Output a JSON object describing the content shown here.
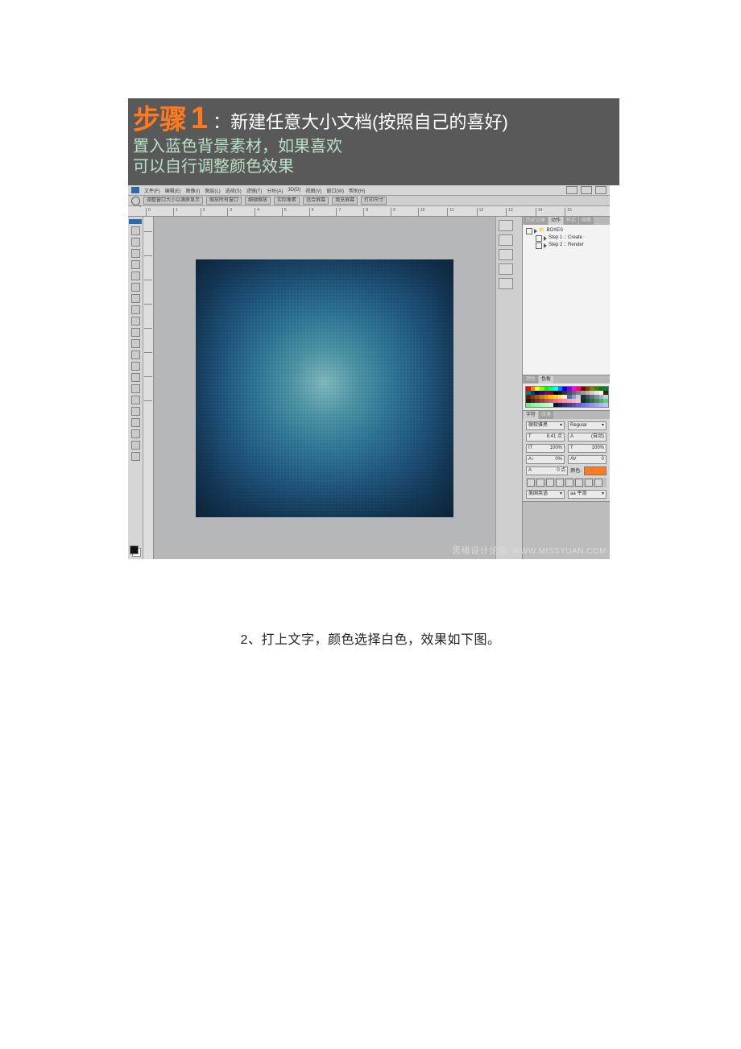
{
  "banner": {
    "step_label": "步骤",
    "step_num": "1",
    "desc": "：新建任意大小文档(按照自己的喜好)",
    "line2": "置入蓝色背景素材，如果喜欢",
    "line3": "可以自行调整颜色效果"
  },
  "menubar": {
    "items": [
      "文件(F)",
      "编辑(E)",
      "图像(I)",
      "图层(L)",
      "选择(S)",
      "滤镜(T)",
      "分析(A)",
      "3D(D)",
      "视图(V)",
      "窗口(W)",
      "帮助(H)"
    ]
  },
  "optbar": {
    "items": [
      "调整窗口大小以满屏显示",
      "缩放所有窗口",
      "细微缩放",
      "实际像素",
      "适合屏幕",
      "填充屏幕",
      "打印尺寸"
    ]
  },
  "ruler_h": [
    "0",
    "1",
    "2",
    "3",
    "4",
    "5",
    "6",
    "7",
    "8",
    "9",
    "10",
    "11",
    "12",
    "13",
    "14",
    "15"
  ],
  "actions": {
    "tab_on": "动作",
    "tab_off1": "历史记录",
    "tab_off2": "样式",
    "tab_off3": "画笔",
    "folder": "BOXES",
    "step1": "Step 1 :: Create",
    "step2": "Step 2 :: Render"
  },
  "swatches": {
    "tab_on": "色板",
    "tab_off": "颜色"
  },
  "typo": {
    "tab_on": "字符",
    "tab_off": "段落",
    "font": "微软雅黑",
    "style": "Regular",
    "size": "8.41 点",
    "leading": "(自动)",
    "tracking": "100%",
    "vscale": "100%",
    "baseline": "0%",
    "color_row_label": "0 点",
    "color_label": "颜色:",
    "lang": "美国英语",
    "aa": "aa  平滑"
  },
  "watermark": {
    "zh": "思缘设计论坛",
    "en": "WWW.MISSYUAN.COM"
  },
  "caption": "2、打上文字，颜色选择白色，效果如下图。",
  "swatch_colors": [
    "#ff0000",
    "#ff7f00",
    "#ffff00",
    "#7fff00",
    "#00ff00",
    "#00ff7f",
    "#00ffff",
    "#007fff",
    "#0000ff",
    "#7f00ff",
    "#ff00ff",
    "#ff007f",
    "#7f0000",
    "#7f3f00",
    "#7f7f00",
    "#3f7f00",
    "#007f00",
    "#007f3f",
    "#007f7f",
    "#003f7f",
    "#00007f",
    "#3f007f",
    "#7f007f",
    "#7f003f",
    "#000000",
    "#191919",
    "#333333",
    "#4c4c4c",
    "#666666",
    "#7f7f7f",
    "#999999",
    "#b2b2b2",
    "#cccccc",
    "#e5e5e5",
    "#ffffff",
    "#402000",
    "#602000",
    "#804000",
    "#a06000",
    "#c08000",
    "#e0a000",
    "#ffc000",
    "#ffcf3f",
    "#ffdf7f",
    "#ffefbf",
    "#3f6fbf",
    "#7f9fcf",
    "#bfcfdf",
    "#203040",
    "#405060",
    "#607080",
    "#8090a0",
    "#a0b0c0",
    "#c0d0e0",
    "#301020",
    "#502030",
    "#703040",
    "#904050",
    "#b05060",
    "#d06070",
    "#f07080",
    "#ff8090",
    "#ff90a0",
    "#ffa0b0",
    "#ffb0c0",
    "#ffc0d0",
    "#103020",
    "#205030",
    "#307040",
    "#409050",
    "#50b060",
    "#60d070",
    "#70f080",
    "#80ff90",
    "#90ffa0",
    "#a0ffb0",
    "#b0ffc0",
    "#c0ffd0",
    "#101030",
    "#202050",
    "#303070",
    "#404090",
    "#5050b0",
    "#6060d0",
    "#7070f0",
    "#8080ff",
    "#9090ff",
    "#a0a0ff",
    "#b0b0ff",
    "#c0c0ff"
  ]
}
